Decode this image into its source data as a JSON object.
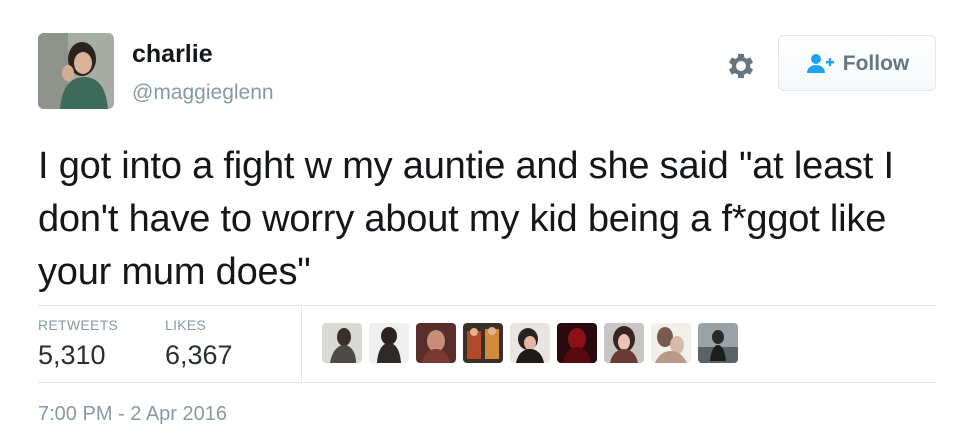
{
  "author": {
    "display_name": "charlie",
    "handle": "@maggieglenn"
  },
  "actions": {
    "settings_icon": "gear-icon",
    "follow_icon": "follow-user-icon",
    "follow_label": "Follow"
  },
  "tweet": {
    "text": "I got into a fight w my auntie and she said \"at least I don't have to worry about my kid being a f*ggot like your mum does\""
  },
  "stats": {
    "retweets_label": "RETWEETS",
    "retweets_value": "5,310",
    "likes_label": "LIKES",
    "likes_value": "6,367"
  },
  "likers_count_shown": 9,
  "timestamp": "7:00 PM - 2 Apr 2016",
  "colors": {
    "text": "#14171a",
    "muted": "#8899a6",
    "divider": "#e1e8ed",
    "follow_icon": "#1da1f2"
  }
}
